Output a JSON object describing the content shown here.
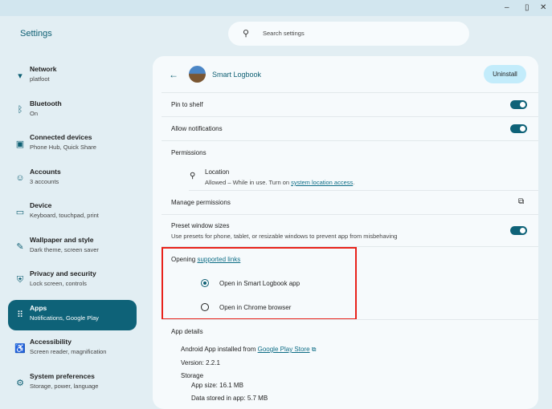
{
  "window": {
    "title": "Settings",
    "controls": [
      "minimize",
      "maximize",
      "close"
    ]
  },
  "search": {
    "placeholder": "Search settings"
  },
  "sidebar": {
    "items": [
      {
        "label": "Network",
        "sub": "platfoot",
        "icon": "wifi-icon"
      },
      {
        "label": "Bluetooth",
        "sub": "On",
        "icon": "bluetooth-icon"
      },
      {
        "label": "Connected devices",
        "sub": "Phone Hub, Quick Share",
        "icon": "devices-icon"
      },
      {
        "label": "Accounts",
        "sub": "3 accounts",
        "icon": "account-icon"
      },
      {
        "label": "Device",
        "sub": "Keyboard, touchpad, print",
        "icon": "laptop-icon"
      },
      {
        "label": "Wallpaper and style",
        "sub": "Dark theme, screen saver",
        "icon": "palette-icon"
      },
      {
        "label": "Privacy and security",
        "sub": "Lock screen, controls",
        "icon": "shield-icon"
      },
      {
        "label": "Apps",
        "sub": "Notifications, Google Play",
        "icon": "apps-grid-icon",
        "active": true
      },
      {
        "label": "Accessibility",
        "sub": "Screen reader, magnification",
        "icon": "accessibility-icon"
      },
      {
        "label": "System preferences",
        "sub": "Storage, power, language",
        "icon": "gear-icon"
      }
    ]
  },
  "app": {
    "name": "Smart Logbook",
    "uninstall": "Uninstall"
  },
  "settings": {
    "pin": "Pin to shelf",
    "pin_on": true,
    "notifications": "Allow notifications",
    "notifications_on": true,
    "permissions": "Permissions",
    "location": "Location",
    "location_sub": "Allowed – While in use. Turn on ",
    "location_link": "system location access",
    "period": ".",
    "manage": "Manage permissions",
    "preset": "Preset window sizes",
    "preset_sub": "Use presets for phone, tablet, or resizable windows to prevent app from misbehaving",
    "preset_on": true,
    "opening": "Opening ",
    "opening_link": "supported links",
    "open_app": "Open in Smart Logbook app",
    "open_browser": "Open in Chrome browser",
    "selected": "app"
  },
  "details": {
    "title": "App details",
    "installed": "Android App installed from ",
    "store": "Google Play Store",
    "version": "Version: 2.2.1",
    "storage": "Storage",
    "app_size": "App size: 16.1 MB",
    "data": "Data stored in app: 5.7 MB"
  }
}
